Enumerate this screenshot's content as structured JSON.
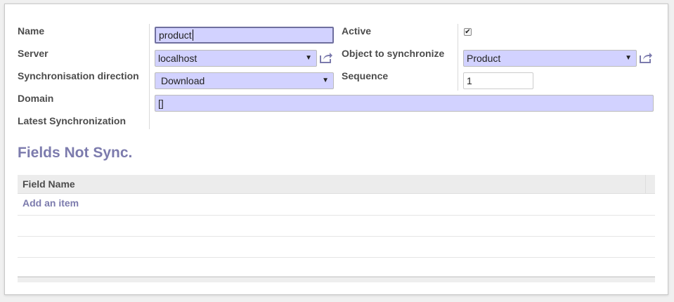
{
  "form": {
    "name_label": "Name",
    "name_value": "product",
    "server_label": "Server",
    "server_value": "localhost",
    "direction_label": "Synchronisation direction",
    "direction_value": "Download",
    "domain_label": "Domain",
    "domain_value": "[]",
    "latest_label": "Latest Synchronization",
    "active_label": "Active",
    "active_checked": true,
    "object_label": "Object to synchronize",
    "object_value": "Product",
    "sequence_label": "Sequence",
    "sequence_value": "1"
  },
  "section": {
    "title": "Fields Not Sync.",
    "column_header": "Field Name",
    "add_item": "Add an item"
  },
  "icons": {
    "external": "external-link-icon",
    "dropdown": "caret-down-icon",
    "checkbox": "checkmark-icon"
  },
  "colors": {
    "required_field": "#d2d2ff",
    "accent": "#7c7bad"
  }
}
